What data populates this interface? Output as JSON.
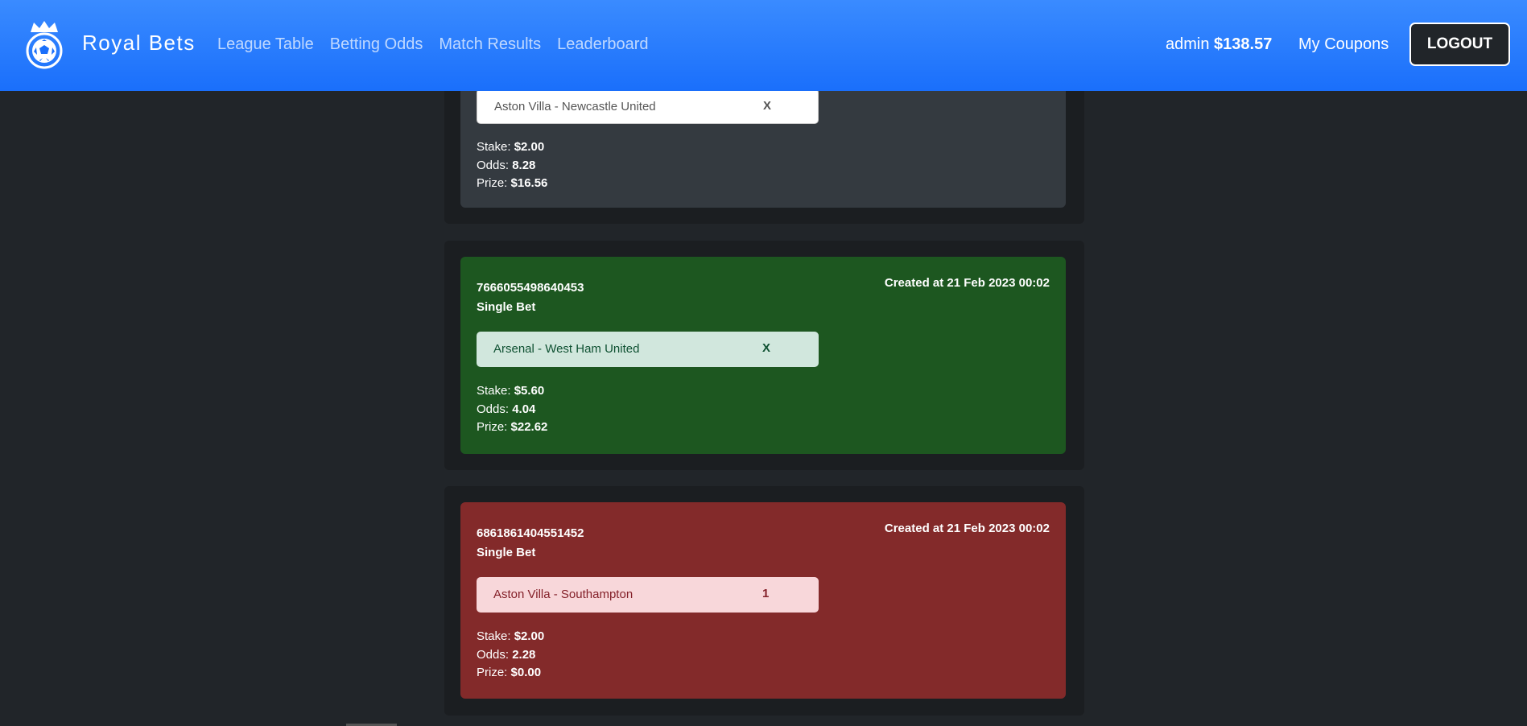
{
  "navbar": {
    "brand": "Royal Bets",
    "links": [
      "League Table",
      "Betting Odds",
      "Match Results",
      "Leaderboard"
    ],
    "username": "admin",
    "balance": "$138.57",
    "my_coupons": "My Coupons",
    "logout": "LOGOUT"
  },
  "coupons": [
    {
      "status": "pending",
      "pick": {
        "match": "Aston Villa - Newcastle United",
        "selection": "X"
      },
      "stake_label": "Stake:",
      "stake": "$2.00",
      "odds_label": "Odds:",
      "odds": "8.28",
      "prize_label": "Prize:",
      "prize": "$16.56"
    },
    {
      "status": "won",
      "id": "7666055498640453",
      "type": "Single Bet",
      "created": "Created at 21 Feb 2023 00:02",
      "pick": {
        "match": "Arsenal - West Ham United",
        "selection": "X"
      },
      "stake_label": "Stake:",
      "stake": "$5.60",
      "odds_label": "Odds:",
      "odds": "4.04",
      "prize_label": "Prize:",
      "prize": "$22.62"
    },
    {
      "status": "lost",
      "id": "6861861404551452",
      "type": "Single Bet",
      "created": "Created at 21 Feb 2023 00:02",
      "pick": {
        "match": "Aston Villa - Southampton",
        "selection": "1"
      },
      "stake_label": "Stake:",
      "stake": "$2.00",
      "odds_label": "Odds:",
      "odds": "2.28",
      "prize_label": "Prize:",
      "prize": "$0.00"
    }
  ],
  "colors": {
    "navbar": "#1a6ffb",
    "background": "#212529",
    "pending_card": "#343a40",
    "won_card": "#1d5720",
    "lost_card": "#832a2a"
  },
  "icons": {
    "logo": "crowned-football-logo-icon"
  }
}
